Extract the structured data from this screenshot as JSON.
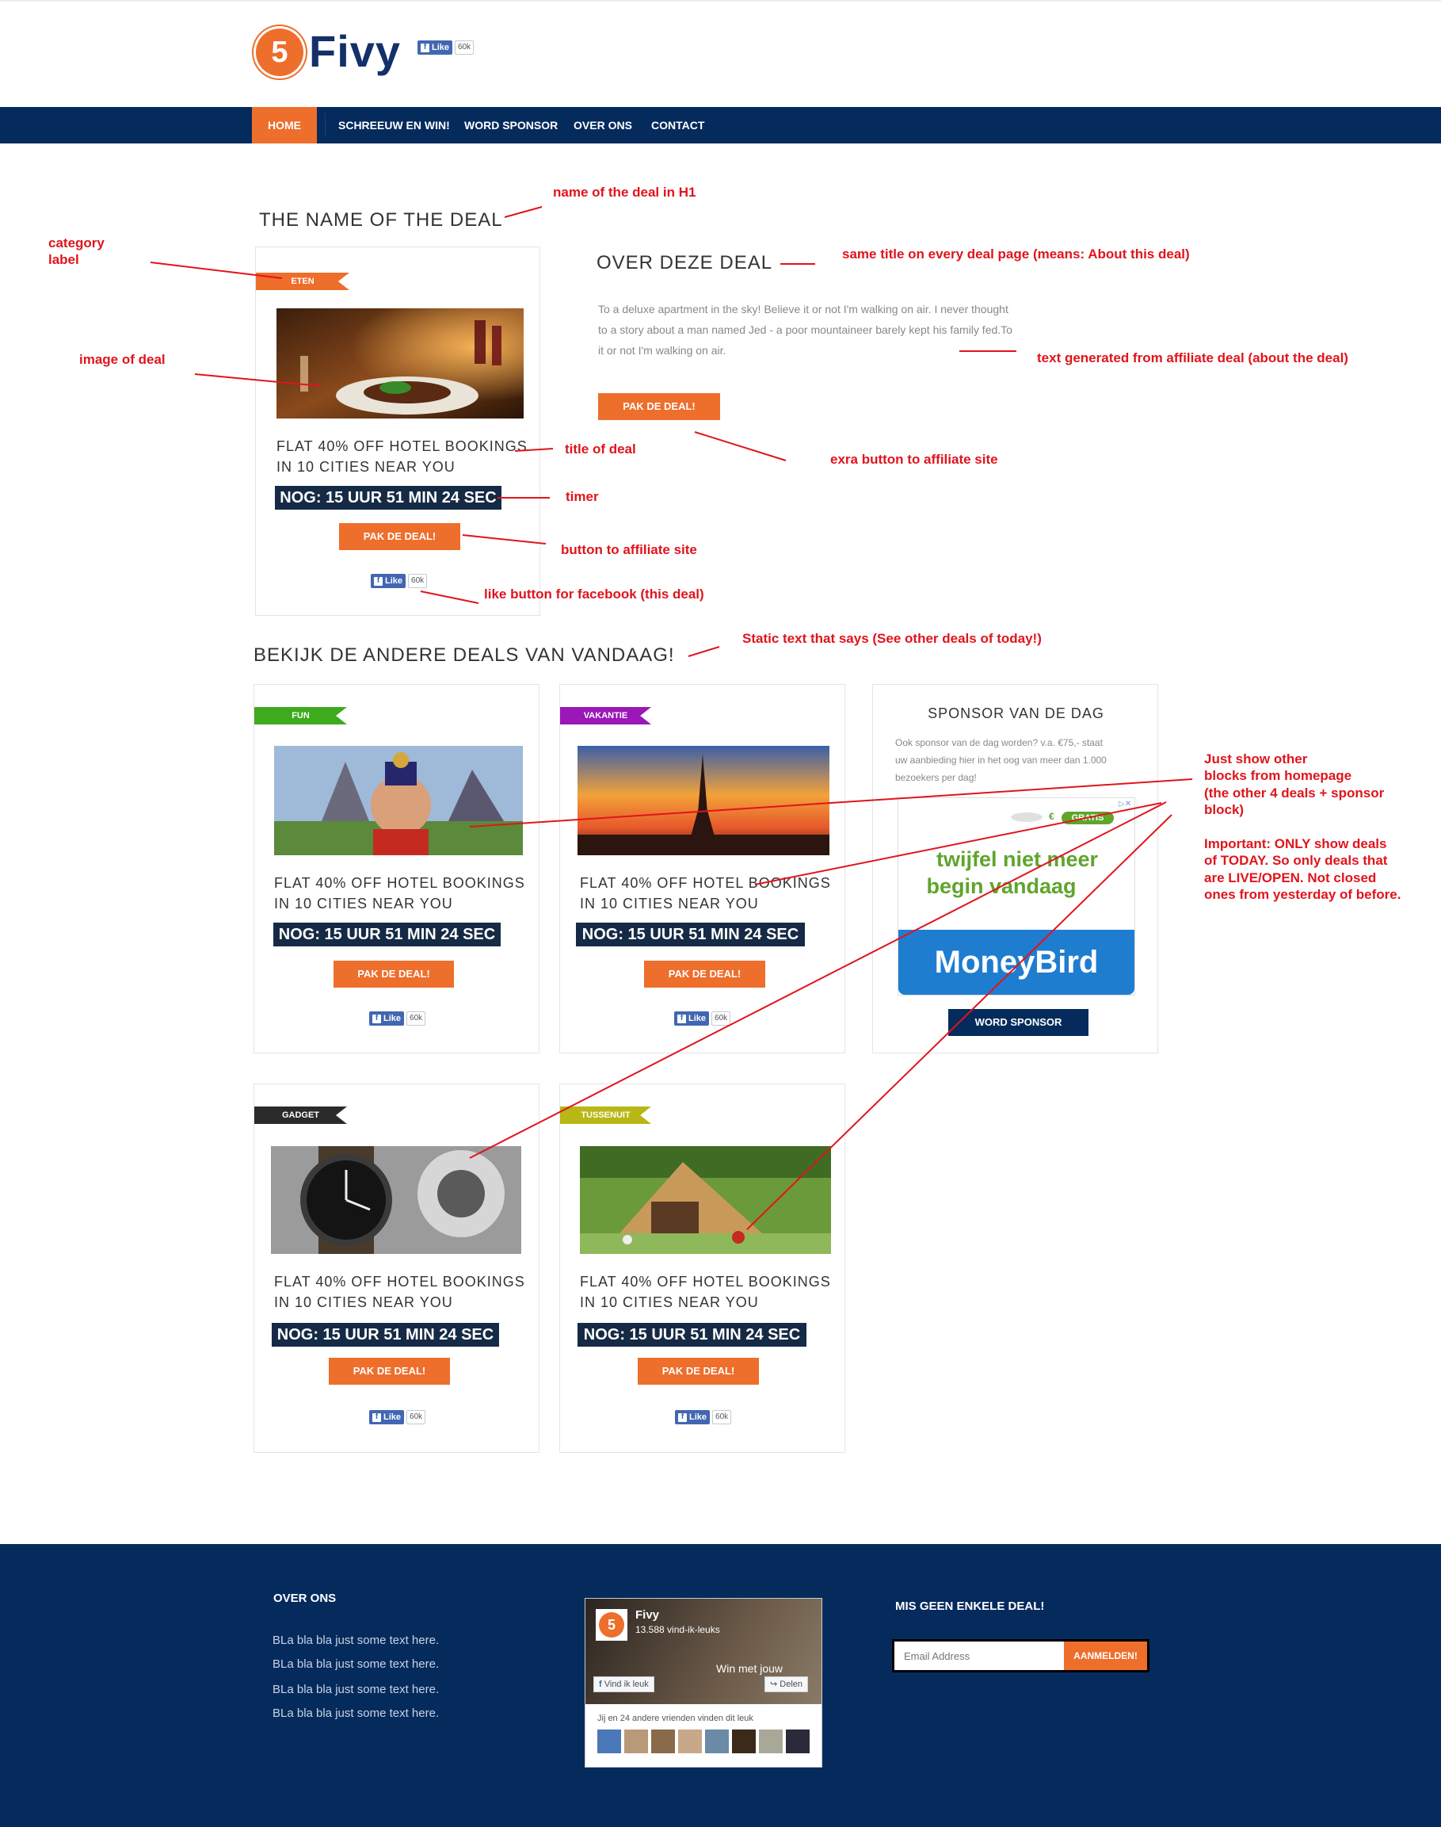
{
  "header": {
    "logo_number": "5",
    "logo_text": "Fivy",
    "fb_like_label": "Like",
    "fb_like_count": "60k"
  },
  "nav": {
    "items": [
      "HOME",
      "SCHREEUW EN WIN!",
      "WORD SPONSOR",
      "OVER ONS",
      "CONTACT"
    ],
    "active": "HOME"
  },
  "deal": {
    "name": "THE NAME OF THE DEAL",
    "category": "ETEN",
    "title_line1": "FLAT 40% OFF HOTEL BOOKINGS",
    "title_line2": "IN 10 CITIES NEAR YOU",
    "timer": "NOG: 15 UUR 51 MIN 24 SEC",
    "button": "PAK DE DEAL!",
    "like_label": "Like",
    "like_count": "60k"
  },
  "about": {
    "title": "OVER DEZE DEAL",
    "text_line1": "To a deluxe apartment in the sky! Believe it or not I'm walking on air. I never thought",
    "text_line2": "to a story about a man named Jed - a poor mountaineer barely kept his family fed.To",
    "text_line3": "it or not I'm walking on air.",
    "button": "PAK DE DEAL!"
  },
  "other_deals": {
    "heading": "BEKIJK DE ANDERE DEALS VAN VANDAAG!",
    "cards": [
      {
        "category": "FUN",
        "color": "#3eaa1e",
        "title_line1": "FLAT 40% OFF HOTEL BOOKINGS",
        "title_line2": "IN 10 CITIES NEAR YOU",
        "timer": "NOG: 15 UUR 51 MIN 24 SEC",
        "button": "PAK DE DEAL!",
        "like_label": "Like",
        "like_count": "60k"
      },
      {
        "category": "VAKANTIE",
        "color": "#9a17b8",
        "title_line1": "FLAT 40% OFF HOTEL BOOKINGS",
        "title_line2": "IN 10 CITIES NEAR YOU",
        "timer": "NOG: 15 UUR 51 MIN 24 SEC",
        "button": "PAK DE DEAL!",
        "like_label": "Like",
        "like_count": "60k"
      },
      {
        "category": "GADGET",
        "color": "#2b2b2b",
        "title_line1": "FLAT 40% OFF HOTEL BOOKINGS",
        "title_line2": "IN 10 CITIES NEAR YOU",
        "timer": "NOG: 15 UUR 51 MIN 24 SEC",
        "button": "PAK DE DEAL!",
        "like_label": "Like",
        "like_count": "60k"
      },
      {
        "category": "TUSSENUIT",
        "color": "#b8b715",
        "title_line1": "FLAT 40% OFF HOTEL BOOKINGS",
        "title_line2": "IN 10 CITIES NEAR YOU",
        "timer": "NOG: 15 UUR 51 MIN 24 SEC",
        "button": "PAK DE DEAL!",
        "like_label": "Like",
        "like_count": "60k"
      }
    ]
  },
  "sponsor": {
    "title": "SPONSOR VAN DE DAG",
    "text_line1": "Ook sponsor van de dag worden? v.a. €75,- staat",
    "text_line2": "uw aanbieding hier in het oog van meer dan 1.000",
    "text_line3": "bezoekers per dag!",
    "ad_badge": "GRATIS",
    "ad_euro": "€",
    "ad_line1": "twijfel niet meer",
    "ad_line2": "begin vandaag",
    "ad_brand": "MoneyBird",
    "button": "WORD SPONSOR"
  },
  "annotations": {
    "h1": "name of the deal in H1",
    "category_line1": "category",
    "category_line2": "label",
    "about_title": "same title on every deal page (means: About this deal)",
    "image": "image of deal",
    "text": "text generated from affiliate deal (about the deal)",
    "title": "title of deal",
    "extra_button": "exra button to affiliate site",
    "timer": "timer",
    "button": "button to affiliate site",
    "like": "like button for facebook (this deal)",
    "static": "Static text that says (See other deals of today!)",
    "blocks": [
      "Just show other",
      "blocks from homepage",
      "(the other 4 deals + sponsor",
      "block)"
    ],
    "important": [
      "Important: ONLY show deals",
      "of TODAY. So only deals that",
      "are LIVE/OPEN. Not closed",
      "ones from yesterday of before."
    ]
  },
  "footer": {
    "about_title": "OVER ONS",
    "about_lines": [
      "BLa bla bla just some text here.",
      "BLa bla bla just some text here.",
      "BLa bla bla just some text here.",
      "BLa bla bla just some text here."
    ],
    "fb_page_name": "Fivy",
    "fb_page_likes": "13.588 vind-ik-leuks",
    "fb_like_button": "Vind ik leuk",
    "fb_share_button": "Delen",
    "fb_cover_text": "Win met jouw",
    "fb_friends_text": "Jij en 24 andere vrienden vinden dit leuk",
    "newsletter_title": "MIS GEEN ENKELE DEAL!",
    "email_placeholder": "Email Address",
    "subscribe_button": "AANMELDEN!"
  }
}
